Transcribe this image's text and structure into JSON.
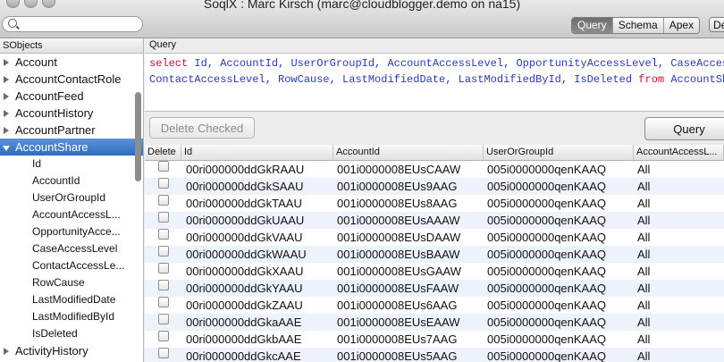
{
  "window": {
    "title": "SoqlX : Marc Kirsch (marc@cloudblogger.demo on na15)"
  },
  "toolbar": {
    "search_placeholder": "",
    "tabs": [
      "Query",
      "Schema",
      "Apex"
    ],
    "active_tab": "Query",
    "truncated_button": "De"
  },
  "sidebar": {
    "header": "SObjects",
    "objects_before": [
      "Account",
      "AccountContactRole",
      "AccountFeed",
      "AccountHistory",
      "AccountPartner"
    ],
    "selected": "AccountShare",
    "children": [
      "Id",
      "AccountId",
      "UserOrGroupId",
      "AccountAccessL...",
      "OpportunityAcce...",
      "CaseAccessLevel",
      "ContactAccessLe...",
      "RowCause",
      "LastModifiedDate",
      "LastModifiedById",
      "IsDeleted"
    ],
    "objects_after": [
      "ActivityHistory"
    ]
  },
  "query": {
    "label": "Query",
    "line1": {
      "kw": "select",
      "fields": "Id, AccountId, UserOrGroupId, AccountAccessLevel, OpportunityAccessLevel, CaseAccessL"
    },
    "line2": {
      "fields": "ContactAccessLevel, RowCause, LastModifiedDate, LastModifiedById, IsDeleted",
      "kw": "from",
      "object": "AccountShar"
    }
  },
  "actions": {
    "delete_checked": "Delete Checked",
    "query": "Query"
  },
  "results": {
    "columns": [
      "Delete",
      "Id",
      "AccountId",
      "UserOrGroupId",
      "AccountAccessL..."
    ],
    "rows": [
      [
        "00ri000000ddGkRAAU",
        "001i0000008EUsCAAW",
        "005i0000000qenKAAQ",
        "All"
      ],
      [
        "00ri000000ddGkSAAU",
        "001i0000008EUs9AAG",
        "005i0000000qenKAAQ",
        "All"
      ],
      [
        "00ri000000ddGkTAAU",
        "001i0000008EUs8AAG",
        "005i0000000qenKAAQ",
        "All"
      ],
      [
        "00ri000000ddGkUAAU",
        "001i0000008EUsAAAW",
        "005i0000000qenKAAQ",
        "All"
      ],
      [
        "00ri000000ddGkVAAU",
        "001i0000008EUsDAAW",
        "005i0000000qenKAAQ",
        "All"
      ],
      [
        "00ri000000ddGkWAAU",
        "001i0000008EUsBAAW",
        "005i0000000qenKAAQ",
        "All"
      ],
      [
        "00ri000000ddGkXAAU",
        "001i0000008EUsGAAW",
        "005i0000000qenKAAQ",
        "All"
      ],
      [
        "00ri000000ddGkYAAU",
        "001i0000008EUsFAAW",
        "005i0000000qenKAAQ",
        "All"
      ],
      [
        "00ri000000ddGkZAAU",
        "001i0000008EUs6AAG",
        "005i0000000qenKAAQ",
        "All"
      ],
      [
        "00ri000000ddGkaAAE",
        "001i0000008EUsEAAW",
        "005i0000000qenKAAQ",
        "All"
      ],
      [
        "00ri000000ddGkbAAE",
        "001i0000008EUs7AAG",
        "005i0000000qenKAAQ",
        "All"
      ],
      [
        "00ri000000ddGkcAAE",
        "001i0000008EUs5AAG",
        "005i0000000qenKAAQ",
        "All"
      ]
    ]
  }
}
